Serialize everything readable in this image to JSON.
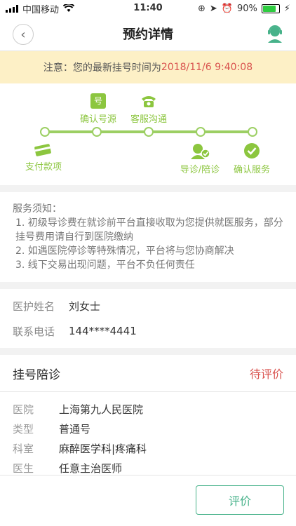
{
  "status_bar": {
    "carrier": "中国移动",
    "time": "11:40",
    "battery": "90%"
  },
  "nav": {
    "title": "预约详情"
  },
  "notice": {
    "prefix": "注意：您的最新挂号时间为",
    "datetime": "2018/11/6 9:40:08"
  },
  "progress": {
    "steps": [
      {
        "label": "支付款项"
      },
      {
        "label": "确认号源"
      },
      {
        "label": "客服沟通"
      },
      {
        "label": "导诊/陪诊"
      },
      {
        "label": "确认服务"
      }
    ],
    "icon_ticket_char": "号"
  },
  "service_notes": {
    "title": "服务须知：",
    "items": [
      "1. 初级导诊费在就诊前平台直接收取为您提供就医服务，部分挂号费用请自行到医院缴纳",
      "2. 如遇医院停诊等特殊情况，平台将与您协商解决",
      "3. 线下交易出现问题，平台不负任何责任"
    ]
  },
  "contact": {
    "name_label": "医护姓名",
    "name_value": "刘女士",
    "phone_label": "联系电话",
    "phone_value": "144****4441"
  },
  "order": {
    "title": "挂号陪诊",
    "status": "待评价",
    "rows": [
      {
        "label": "医院",
        "value": "上海第九人民医院"
      },
      {
        "label": "类型",
        "value": "普通号"
      },
      {
        "label": "科室",
        "value": "麻醉医学科|疼痛科"
      },
      {
        "label": "医生",
        "value": "任意主治医师"
      }
    ]
  },
  "bottom": {
    "rate_label": "评价"
  },
  "colors": {
    "accent": "#47b28a",
    "progress": "#9ccf63",
    "alert": "#d9534f"
  }
}
